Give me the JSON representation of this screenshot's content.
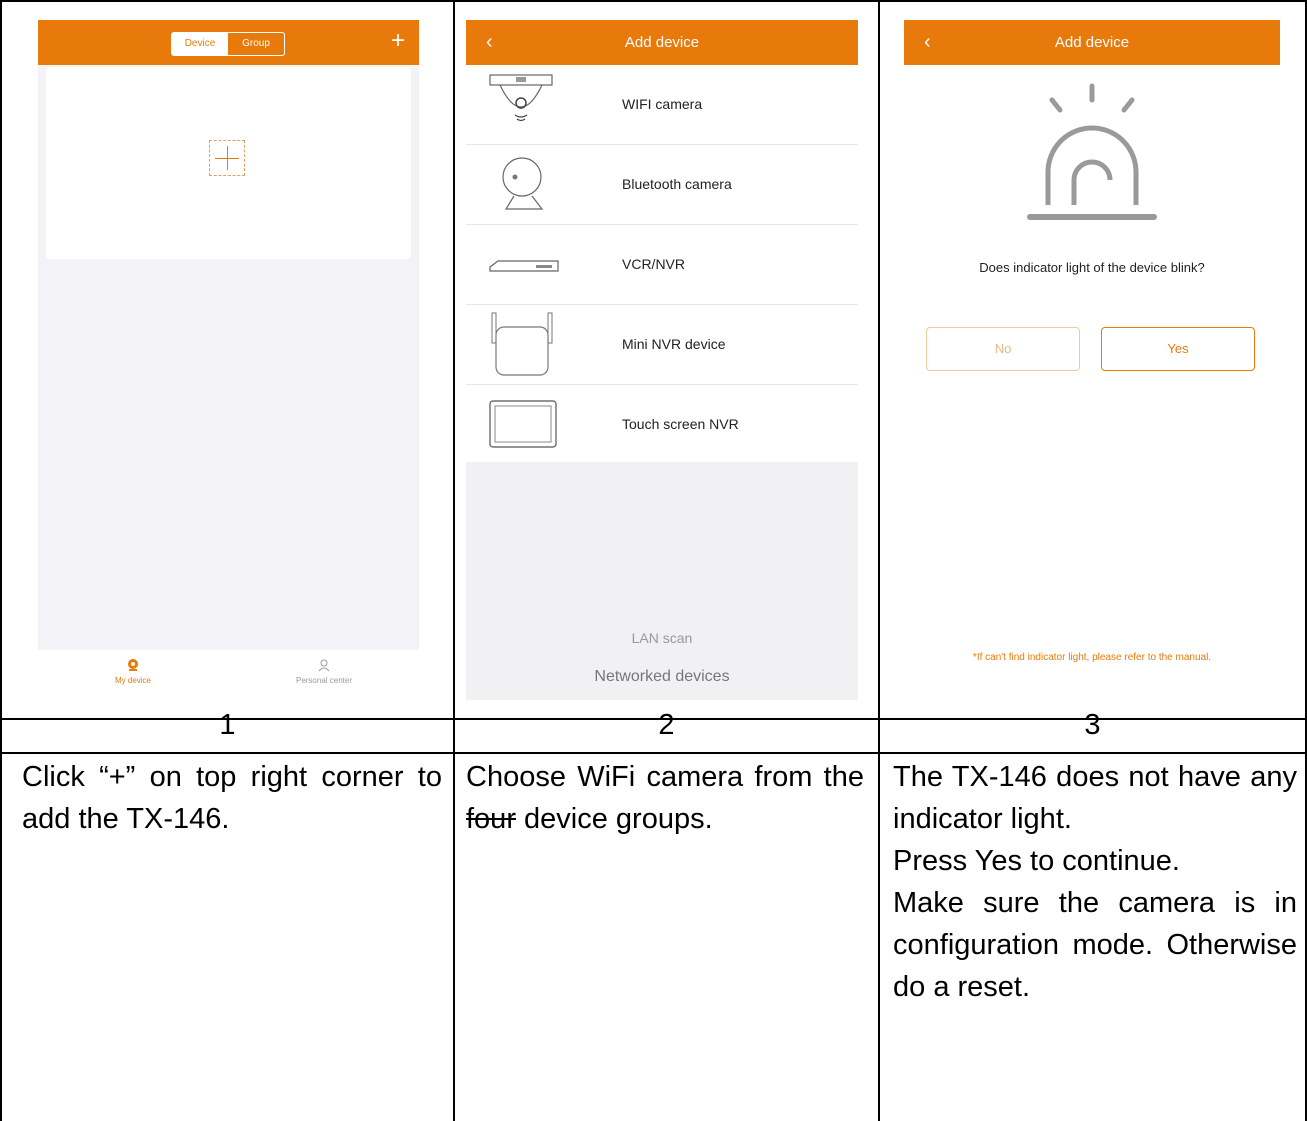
{
  "step1": {
    "number": "1",
    "screen": {
      "seg_device": "Device",
      "seg_group": "Group",
      "plus": "+",
      "tab_my_device": "My device",
      "tab_personal_center": "Personal center"
    },
    "description": "Click “+” on top right corner to add the TX-146."
  },
  "step2": {
    "number": "2",
    "screen": {
      "title": "Add device",
      "back": "‹",
      "items": [
        "WIFI camera",
        "Bluetooth camera",
        "VCR/NVR",
        "Mini NVR device",
        "Touch screen NVR"
      ],
      "lan_scan": "LAN scan",
      "networked_devices": "Networked devices"
    },
    "description": {
      "before": "Choose WiFi camera from the ",
      "struck": "four",
      "after": " device groups."
    }
  },
  "step3": {
    "number": "3",
    "screen": {
      "title": "Add device",
      "back": "‹",
      "question": "Does indicator light of the device blink?",
      "no": "No",
      "yes": "Yes",
      "note": "*If can't find indicator light, please refer to the manual."
    },
    "description": [
      "The TX-146 does not have any indicator light.",
      "Press Yes to continue.",
      "Make sure the camera is in configuration mode. Otherwise do a reset."
    ]
  },
  "colors": {
    "accent": "#e87a0c",
    "page_bg": "#ffffff"
  }
}
